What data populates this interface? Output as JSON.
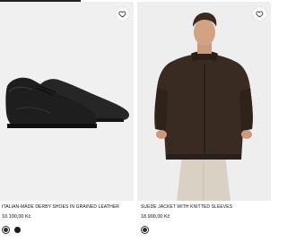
{
  "products": [
    {
      "name": "ITALIAN-MADE DERBY SHOES IN GRAINED LEATHER",
      "price": "10.100,00 Kč",
      "wishlist_icon": "heart-outline-icon",
      "swatches": [
        {
          "color": "#2b2b2b",
          "selected": true
        },
        {
          "color": "#1a1a1a",
          "selected": false
        }
      ]
    },
    {
      "name": "SUEDE JACKET WITH KNITTED SLEEVES",
      "price": "18.900,00 Kč",
      "wishlist_icon": "heart-outline-icon",
      "swatches": [
        {
          "color": "#2e2a26",
          "selected": true
        }
      ]
    }
  ]
}
